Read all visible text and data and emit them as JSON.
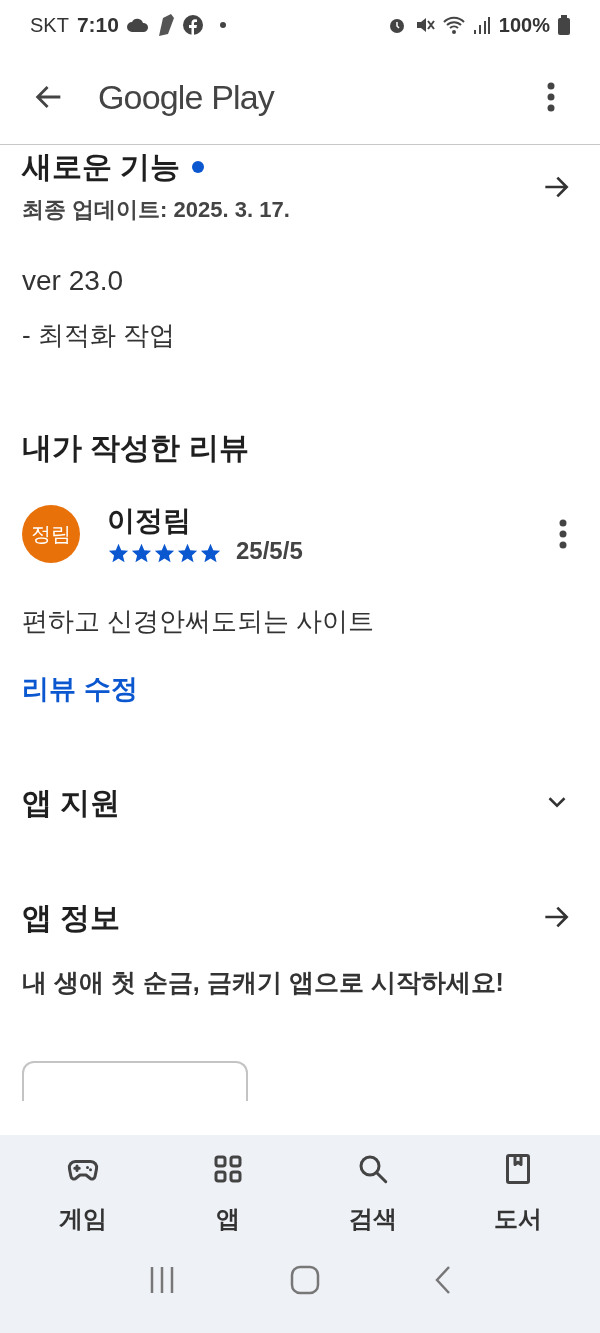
{
  "status_bar": {
    "carrier": "SKT",
    "time": "7:10",
    "battery": "100%"
  },
  "app_bar": {
    "title": "Google Play"
  },
  "whats_new": {
    "title": "새로운 기능",
    "new_dot": true,
    "updated": "최종 업데이트: 2025. 3. 17.",
    "version": "ver 23.0",
    "notes": "- 최적화 작업"
  },
  "my_review": {
    "title": "내가 작성한 리뷰",
    "avatar": "정림",
    "author": "이정림",
    "stars": 5,
    "date": "25/5/5",
    "text": "편하고 신경안써도되는 사이트",
    "edit_link": "리뷰 수정"
  },
  "sections": [
    {
      "kind": "expand",
      "title": "앱 지원",
      "expanded": false
    },
    {
      "kind": "link",
      "title": "앱 정보",
      "description": "내 생애 첫 순금, 금캐기 앱으로 시작하세요!"
    }
  ],
  "bottom_nav": [
    {
      "kind": "games",
      "label": "게임",
      "selected": false
    },
    {
      "kind": "apps",
      "label": "앱",
      "selected": false
    },
    {
      "kind": "search",
      "label": "검색",
      "selected": false
    },
    {
      "kind": "books",
      "label": "도서",
      "selected": false
    }
  ]
}
